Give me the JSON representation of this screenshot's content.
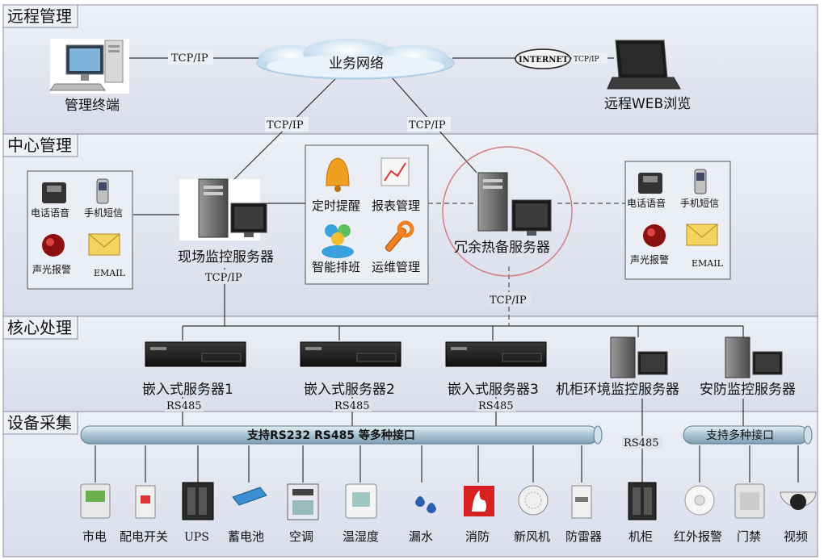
{
  "sections": {
    "remote": "远程管理",
    "center": "中心管理",
    "core": "核心处理",
    "device": "设备采集"
  },
  "remote": {
    "terminal": "管理终端",
    "network": "业务网络",
    "internet": "INTERNET",
    "web": "远程WEB浏览",
    "tcp_left": "TCP/IP",
    "tcp_right": "TCP/IP",
    "tcp_down_left": "TCP/IP",
    "tcp_down_right": "TCP/IP"
  },
  "center": {
    "left_alarm": {
      "phone": "电话语音",
      "sms": "手机短信",
      "siren": "声光报警",
      "email": "EMAIL"
    },
    "right_alarm": {
      "phone": "电话语音",
      "sms": "手机短信",
      "siren": "声光报警",
      "email": "EMAIL"
    },
    "site_server": "现场监控服务器",
    "backup_server": "冗余热备服务器",
    "functions": {
      "timer": "定时提醒",
      "report": "报表管理",
      "schedule": "智能排班",
      "ops": "运维管理"
    },
    "tcp_site": "TCP/IP",
    "tcp_backup": "TCP/IP"
  },
  "core": {
    "servers": [
      "嵌入式服务器1",
      "嵌入式服务器2",
      "嵌入式服务器3"
    ],
    "cabinet_server": "机柜环境监控服务器",
    "security_server": "安防监控服务器",
    "rs485": [
      "RS485",
      "RS485",
      "RS485",
      "RS485"
    ]
  },
  "device": {
    "bus_main": "支持RS232  RS485  等多种接口",
    "bus_sec": "支持多种接口",
    "items": [
      "市电",
      "配电开关",
      "UPS",
      "蓄电池",
      "空调",
      "温湿度",
      "漏水",
      "消防",
      "新风机",
      "防雷器",
      "机柜",
      "红外报警",
      "门禁",
      "视频"
    ]
  }
}
